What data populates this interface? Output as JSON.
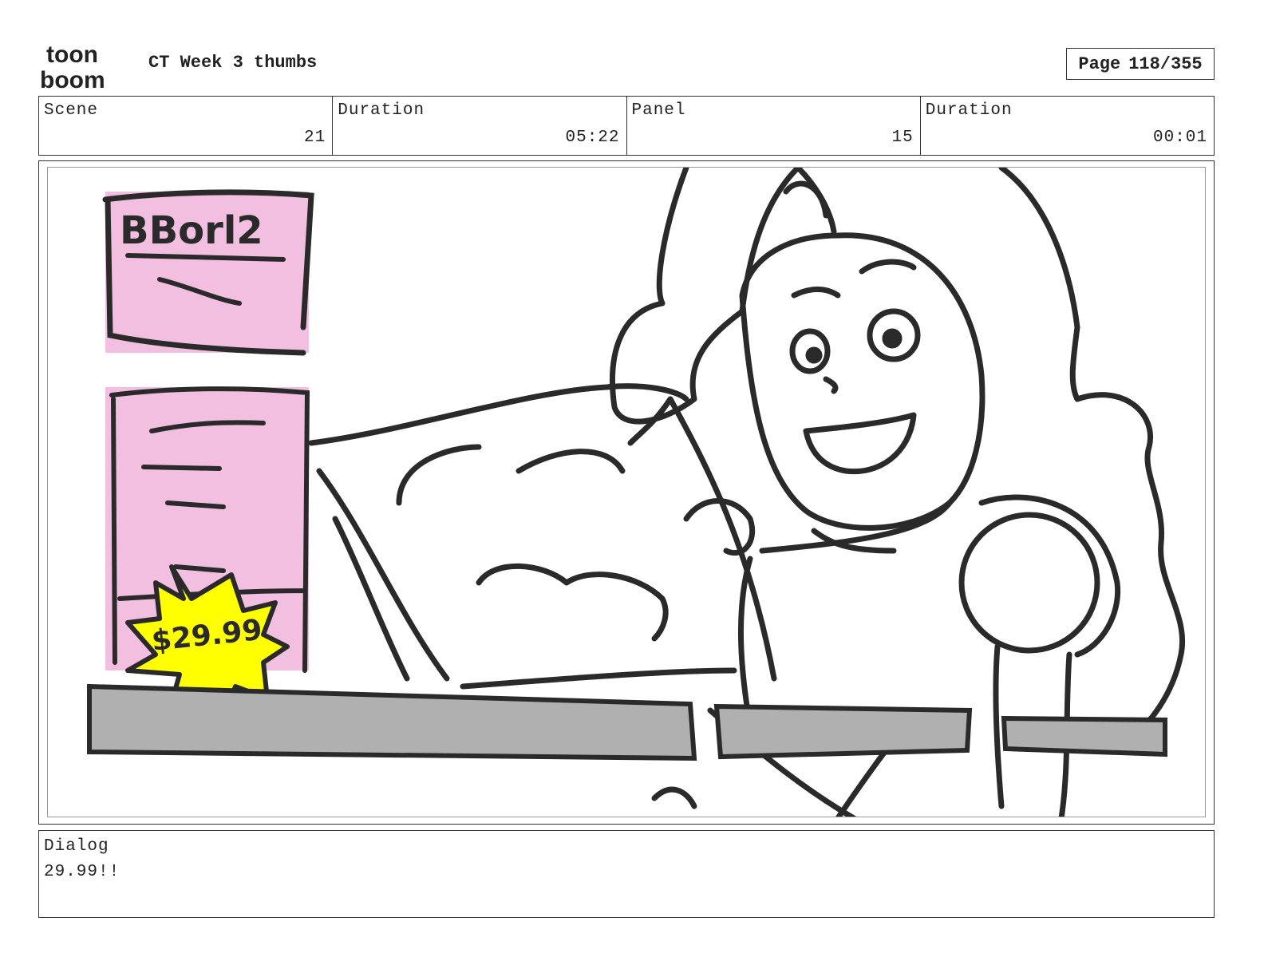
{
  "header": {
    "logo_text_top": "toon",
    "logo_text_bottom": "boom",
    "title": "CT Week 3 thumbs",
    "page_label": "Page",
    "page_value": "118/355"
  },
  "info": {
    "scene_label": "Scene",
    "scene_value": "21",
    "scene_duration_label": "Duration",
    "scene_duration_value": "05:22",
    "panel_label": "Panel",
    "panel_value": "15",
    "panel_duration_label": "Duration",
    "panel_duration_value": "00:01"
  },
  "panel": {
    "box_text": "BBorl2",
    "price_tag": "$29.99",
    "colors": {
      "box": "#f3bfe0",
      "tag": "#ffff00",
      "shelf": "#b0b0b0",
      "ink": "#2a2a2a"
    }
  },
  "dialog": {
    "label": "Dialog",
    "text": "29.99!!"
  }
}
